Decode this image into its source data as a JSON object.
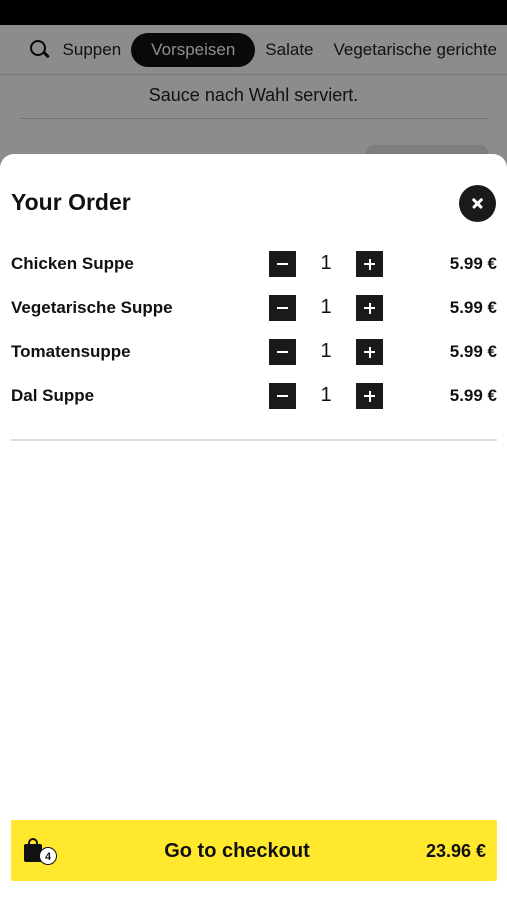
{
  "nav": {
    "tabs": [
      {
        "label": "Suppen",
        "active": false
      },
      {
        "label": "Vorspeisen",
        "active": true
      },
      {
        "label": "Salate",
        "active": false
      },
      {
        "label": "Vegetarische gerichte",
        "active": false
      }
    ]
  },
  "background": {
    "description": "Sauce nach Wahl serviert."
  },
  "sheet": {
    "title": "Your Order",
    "items": [
      {
        "name": "Chicken Suppe",
        "qty": "1",
        "price": "5.99 €"
      },
      {
        "name": "Vegetarische Suppe",
        "qty": "1",
        "price": "5.99 €"
      },
      {
        "name": "Tomatensuppe",
        "qty": "1",
        "price": "5.99 €"
      },
      {
        "name": "Dal Suppe",
        "qty": "1",
        "price": "5.99 €"
      }
    ]
  },
  "checkout": {
    "label": "Go to checkout",
    "total": "23.96 €",
    "bag_count": "4"
  },
  "colors": {
    "accent_yellow": "#ffe82d",
    "dark": "#1a1a1a"
  },
  "icons": {
    "search": "search-icon",
    "close": "close-icon",
    "minus": "minus-icon",
    "plus": "plus-icon",
    "bag": "shopping-bag-icon"
  }
}
